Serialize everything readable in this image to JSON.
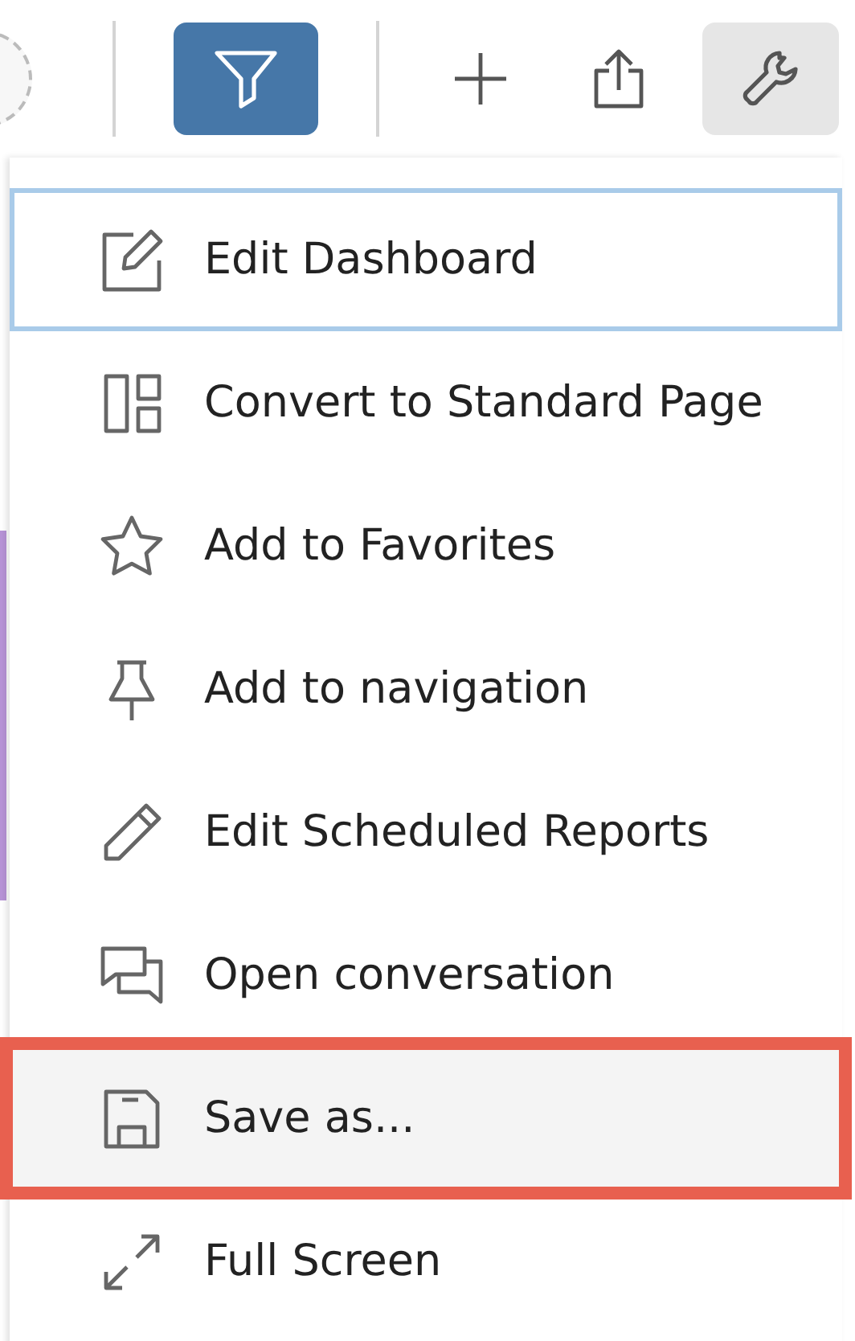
{
  "toolbar": {
    "tools": [
      {
        "kind": "add-circle"
      },
      {
        "kind": "filter",
        "active": true
      },
      {
        "kind": "plus",
        "active": false
      },
      {
        "kind": "share",
        "active": false
      },
      {
        "kind": "wrench",
        "active": true
      }
    ]
  },
  "menu": {
    "items": [
      {
        "kind": "edit",
        "label": "Edit Dashboard",
        "focused": true,
        "highlighted": false
      },
      {
        "kind": "layout",
        "label": "Convert to Standard Page",
        "focused": false,
        "highlighted": false
      },
      {
        "kind": "star",
        "label": "Add to Favorites",
        "focused": false,
        "highlighted": false
      },
      {
        "kind": "pin",
        "label": "Add to navigation",
        "focused": false,
        "highlighted": false
      },
      {
        "kind": "pencil",
        "label": "Edit Scheduled Reports",
        "focused": false,
        "highlighted": false
      },
      {
        "kind": "chat",
        "label": "Open conversation",
        "focused": false,
        "highlighted": false
      },
      {
        "kind": "save",
        "label": "Save as...",
        "focused": false,
        "highlighted": true
      },
      {
        "kind": "expand",
        "label": "Full Screen",
        "focused": false,
        "highlighted": false
      }
    ]
  }
}
